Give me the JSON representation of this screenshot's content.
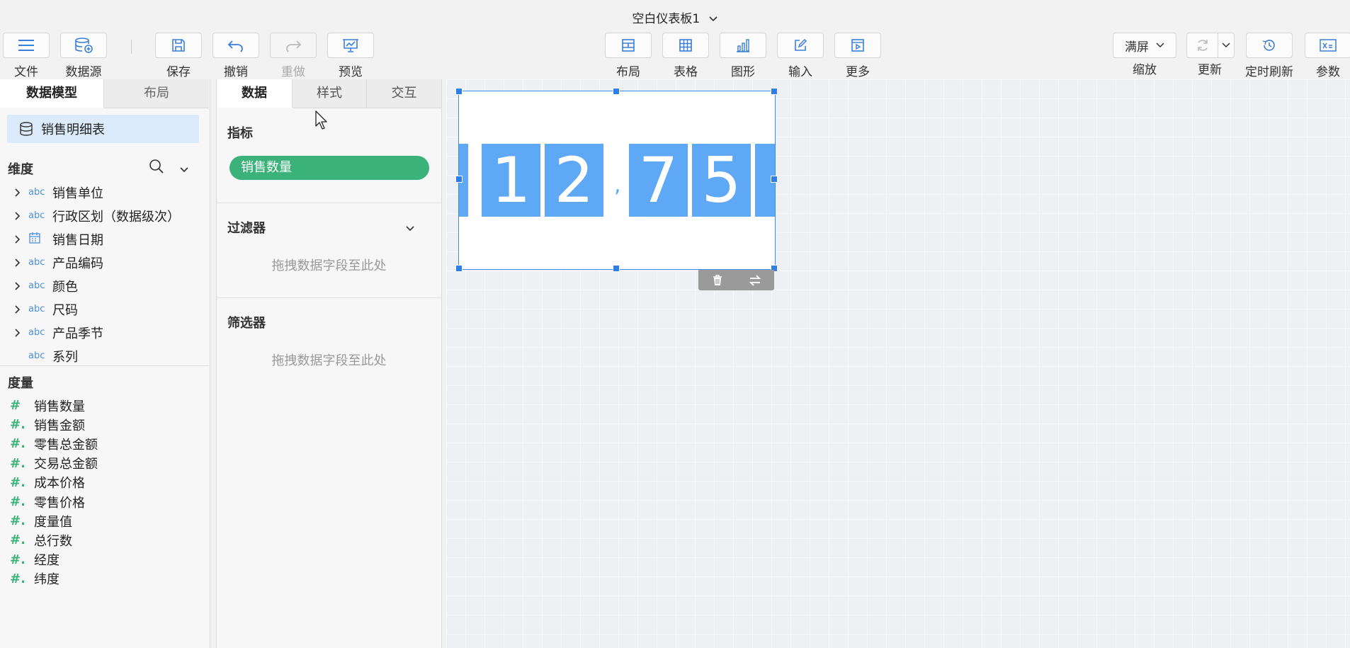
{
  "title": "空白仪表板1",
  "toolbar": {
    "file": "文件",
    "datasource": "数据源",
    "save": "保存",
    "undo": "撤销",
    "redo": "重做",
    "preview": "预览",
    "layout": "布局",
    "table": "表格",
    "chart": "图形",
    "input": "输入",
    "more": "更多",
    "zoom_value": "满屏",
    "zoom": "缩放",
    "refresh": "更新",
    "timed_refresh": "定时刷新",
    "params": "参数"
  },
  "left_panel": {
    "tabs": [
      "数据模型",
      "布局"
    ],
    "dataset": "销售明细表",
    "dimensions_title": "维度",
    "dimensions": [
      {
        "label": "销售单位",
        "type": "abc",
        "expandable": true
      },
      {
        "label": "行政区划（数据级次）",
        "type": "abc",
        "expandable": true
      },
      {
        "label": "销售日期",
        "type": "calendar-icon",
        "expandable": true
      },
      {
        "label": "产品编码",
        "type": "abc",
        "expandable": true
      },
      {
        "label": "颜色",
        "type": "abc",
        "expandable": true
      },
      {
        "label": "尺码",
        "type": "abc",
        "expandable": true
      },
      {
        "label": "产品季节",
        "type": "abc",
        "expandable": true
      },
      {
        "label": "系列",
        "type": "abc",
        "expandable": false
      }
    ],
    "measures_title": "度量",
    "measures": [
      {
        "label": "销售数量",
        "icon": "#"
      },
      {
        "label": "销售金额",
        "icon": "#."
      },
      {
        "label": "零售总金额",
        "icon": "#."
      },
      {
        "label": "交易总金额",
        "icon": "#."
      },
      {
        "label": "成本价格",
        "icon": "#."
      },
      {
        "label": "零售价格",
        "icon": "#."
      },
      {
        "label": "度量值",
        "icon": "#."
      },
      {
        "label": "总行数",
        "icon": "#."
      },
      {
        "label": "经度",
        "icon": "#."
      },
      {
        "label": "纬度",
        "icon": "#."
      }
    ]
  },
  "mid_panel": {
    "tabs": [
      "数据",
      "样式",
      "交互"
    ],
    "indicator_title": "指标",
    "indicator_field": "销售数量",
    "filter_title": "过滤器",
    "filter_hint": "拖拽数据字段至此处",
    "selector_title": "筛选器",
    "selector_hint": "拖拽数据字段至此处"
  },
  "widget": {
    "digits": [
      "1",
      "2",
      "7",
      "5"
    ],
    "separator": ",",
    "accent": "#5fa8f5"
  },
  "colors": {
    "selection": "#2e7de9",
    "pill": "#3bb27a",
    "dataset_bg": "#dcebfb"
  }
}
